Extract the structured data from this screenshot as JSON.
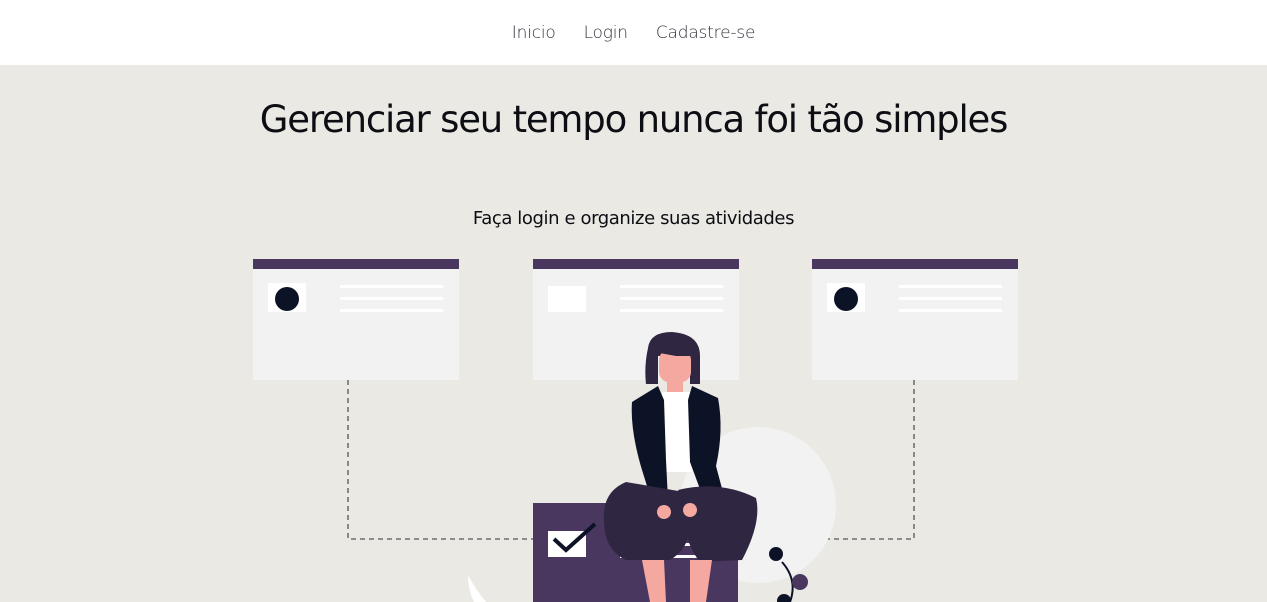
{
  "nav": {
    "items": [
      {
        "label": "Inicio"
      },
      {
        "label": "Login"
      },
      {
        "label": "Cadastre-se"
      }
    ]
  },
  "hero": {
    "title": "Gerenciar seu tempo nunca foi tão simples",
    "subtitle": "Faça login e organize suas atividades"
  },
  "colors": {
    "background": "#ebe9e4",
    "nav_background": "#ffffff",
    "accent": "#4a3760",
    "card": "#f2f2f2",
    "dark": "#0d1326"
  },
  "illustration": {
    "icons": [
      "avatar-card",
      "image-card",
      "avatar-card",
      "person-sitting",
      "checkbox-box"
    ]
  }
}
